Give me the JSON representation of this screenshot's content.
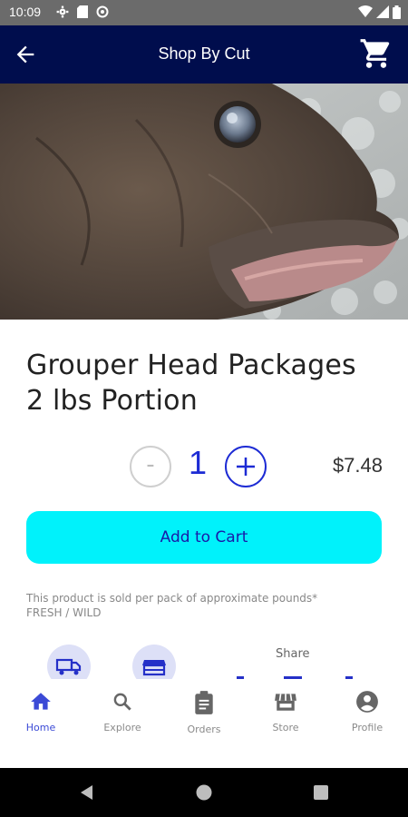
{
  "status_bar": {
    "time": "10:09"
  },
  "app_bar": {
    "title": "Shop By Cut"
  },
  "product": {
    "title_line1": "Grouper Head Packages",
    "title_line2": "2 lbs Portion",
    "quantity": "1",
    "price": "$7.48",
    "minus_label": "-",
    "note_line1": "This product is sold per pack of approximate pounds*",
    "note_line2": "FRESH / WILD"
  },
  "actions": {
    "add_to_cart": "Add to Cart",
    "share_label": "Share"
  },
  "bottom_nav": [
    {
      "label": "Home",
      "icon": "home-icon",
      "active": true
    },
    {
      "label": "Explore",
      "icon": "search-icon",
      "active": false
    },
    {
      "label": "Orders",
      "icon": "clipboard-icon",
      "active": false
    },
    {
      "label": "Store",
      "icon": "store-icon",
      "active": false
    },
    {
      "label": "Profile",
      "icon": "account-icon",
      "active": false
    }
  ],
  "colors": {
    "appbar_bg": "#000d4d",
    "accent_blue": "#1d2bd4",
    "add_to_cart_bg": "#00f2fb",
    "nav_active": "#3b4ad6"
  }
}
